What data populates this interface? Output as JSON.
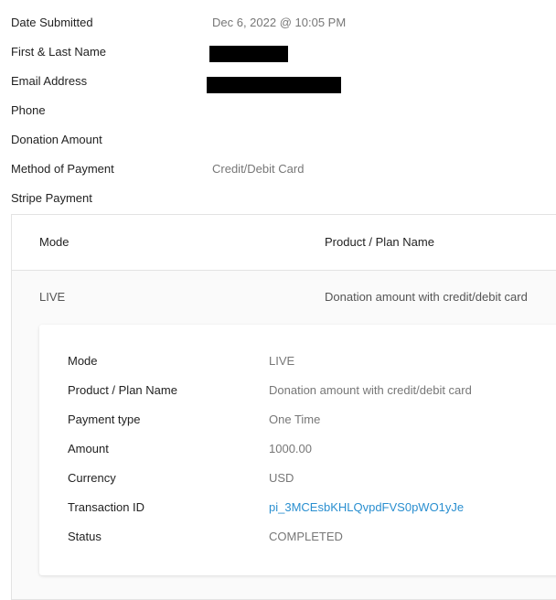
{
  "submission": {
    "fields": [
      {
        "label": "Date Submitted",
        "value": "Dec 6, 2022 @ 10:05 PM"
      },
      {
        "label": "First & Last Name",
        "value": ""
      },
      {
        "label": "Email Address",
        "value": ""
      },
      {
        "label": "Phone",
        "value": ""
      },
      {
        "label": "Donation Amount",
        "value": ""
      },
      {
        "label": "Method of Payment",
        "value": "Credit/Debit Card"
      },
      {
        "label": "Stripe Payment",
        "value": ""
      }
    ]
  },
  "stripe": {
    "headers": {
      "mode": "Mode",
      "product": "Product / Plan Name"
    },
    "row": {
      "mode": "LIVE",
      "product": "Donation amount with credit/debit card"
    },
    "details": [
      {
        "label": "Mode",
        "value": "LIVE"
      },
      {
        "label": "Product / Plan Name",
        "value": "Donation amount with credit/debit card"
      },
      {
        "label": "Payment type",
        "value": "One Time"
      },
      {
        "label": "Amount",
        "value": "1000.00"
      },
      {
        "label": "Currency",
        "value": "USD"
      },
      {
        "label": "Transaction ID",
        "value": "pi_3MCEsbKHLQvpdFVS0pWO1yJe"
      },
      {
        "label": "Status",
        "value": "COMPLETED"
      }
    ]
  },
  "colors": {
    "link": "#2a8fd0",
    "label": "#222222",
    "value": "#777777"
  }
}
